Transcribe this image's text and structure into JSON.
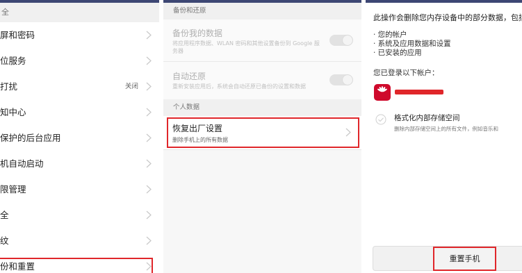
{
  "panel1": {
    "header": "全",
    "items": [
      {
        "label": "屏和密码",
        "value": ""
      },
      {
        "label": "位服务",
        "value": ""
      },
      {
        "label": "打扰",
        "value": "关闭"
      },
      {
        "label": "知中心",
        "value": ""
      },
      {
        "label": "保护的后台应用",
        "value": ""
      },
      {
        "label": "机自动启动",
        "value": ""
      },
      {
        "label": "限管理",
        "value": ""
      },
      {
        "label": "全",
        "value": ""
      },
      {
        "label": "纹",
        "value": ""
      },
      {
        "label": "份和重置",
        "value": ""
      }
    ]
  },
  "panel2": {
    "section1": "备份和还原",
    "backup": {
      "title": "备份我的数据",
      "desc": "将应用程序数据、WLAN 密码和其他设置备份到 Google 服务器"
    },
    "restore": {
      "title": "自动还原",
      "desc": "重新安装应用后，系统会自动还原已备份的设置和数据"
    },
    "section2": "个人数据",
    "factory": {
      "title": "恢复出厂设置",
      "desc": "删除手机上的所有数据"
    }
  },
  "panel3": {
    "warning": "此操作会删除您内存设备中的部分数据，包括",
    "bullets": [
      "· 您的帐户",
      "· 系统及应用数据和设置",
      "· 已安装的应用"
    ],
    "logged_in": "您已登录以下帐户：",
    "format_title": "格式化内部存储空间",
    "format_desc": "删除内部存储空间上的所有文件，例如音乐和",
    "reset_button": "重置手机"
  },
  "colors": {
    "highlight": "#e0262a",
    "topbar": "#3d4774",
    "huawei": "#cf0a2c"
  }
}
